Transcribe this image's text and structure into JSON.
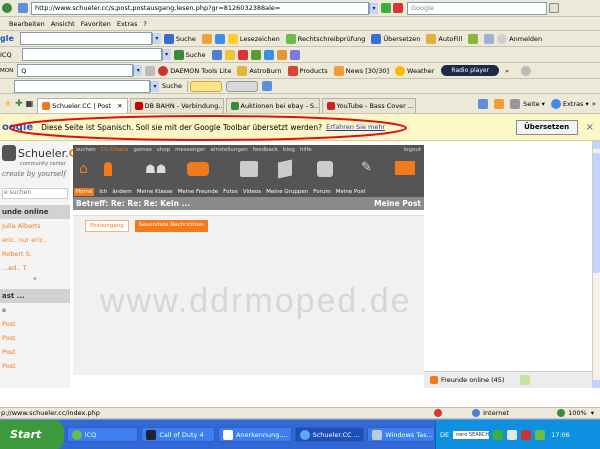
{
  "address": {
    "url": "http://www.schueler.cc/s,post,postausgang,lesen.php?gr=8126032388ale=",
    "search_placeholder": "Google"
  },
  "menu": [
    "Bearbeiten",
    "Ansicht",
    "Favoriten",
    "Extras",
    "?"
  ],
  "google_tb1": {
    "logo": "gle",
    "suche": "Suche",
    "lesezeichen": "Lesezeichen",
    "recht": "Rechtschreibprüfung",
    "ubersetzen": "Übersetzen",
    "autofill": "AutoFill",
    "anmelden": "Anmelden"
  },
  "tb2": {
    "icq": "ICQ",
    "suche": "Suche"
  },
  "tb3": {
    "label": "MON",
    "search": "Q",
    "daemon": "DAEMON Tools Lite",
    "astroburn": "AstroBurn",
    "products": "Products",
    "news": "News [30/30]",
    "weather": "Weather",
    "radio": "Radio player"
  },
  "tb4": {
    "suche": "Suche"
  },
  "tabs": [
    {
      "label": "Schueler.CC | Post",
      "color": "#f37a1a"
    },
    {
      "label": "DB BAHN - Verbindung...",
      "color": "#cc0000"
    },
    {
      "label": "Auktionen bei ebay - S...",
      "color": "#3a8a3a"
    },
    {
      "label": "YouTube - Bass Cover ...",
      "color": "#cc2222"
    }
  ],
  "tab_tools": {
    "seite": "Seite",
    "extras": "Extras"
  },
  "google_translate": {
    "logo": "oogle",
    "message": "Diese Seite ist Spanisch. Soll sie mit der Google Toolbar übersetzt werden?",
    "link": "Erfahren Sie mehr",
    "button": "Übersetzen",
    "close": "×"
  },
  "site": {
    "logo": "Schueler.",
    "logo_cc": "CC",
    "logo_sub": "community center",
    "slogan": "create by yourself",
    "top_links": [
      "suchen",
      "CC-Charts",
      "games",
      "shop",
      "messenger",
      "einstellungen",
      "feedback",
      "blog",
      "hilfe"
    ],
    "logout": "logout",
    "nav": [
      "Home",
      "Ich",
      "ändern",
      "Meine Klasse",
      "Meine Freunde",
      "Fotos",
      "Videos",
      "Meine Gruppen",
      "Forum",
      "Meine Post"
    ],
    "title": "Betreff: Re: Re: Re: Kein ...",
    "title_right": "Meine Post",
    "subtabs": [
      "Posteingang",
      "Gesendete Nachrichten"
    ],
    "watermark": "www.ddrmoped.de",
    "search_label": "e suchen",
    "friends_online_header": "unde online",
    "friends": [
      "Julia Alberts",
      "eric. nur eric.",
      "Robert S.",
      "...ed.. T"
    ],
    "post_header": "ast ...",
    "post_items": [
      "e",
      "Post",
      "Post",
      "Post",
      "Post"
    ],
    "friends_footer": "Freunde online (45)"
  },
  "status": {
    "url": "p://www.schueler.cc/index.php",
    "zone": "Internet",
    "zoom": "100%"
  },
  "taskbar": {
    "start": "Start",
    "buttons": [
      "ICQ",
      "Call of Duty 4",
      "Anerkennung....",
      "Schueler.CC ...",
      "Windows Tas..."
    ],
    "lang": "DE",
    "nero": "nero SEARCH",
    "time": "17:06"
  }
}
